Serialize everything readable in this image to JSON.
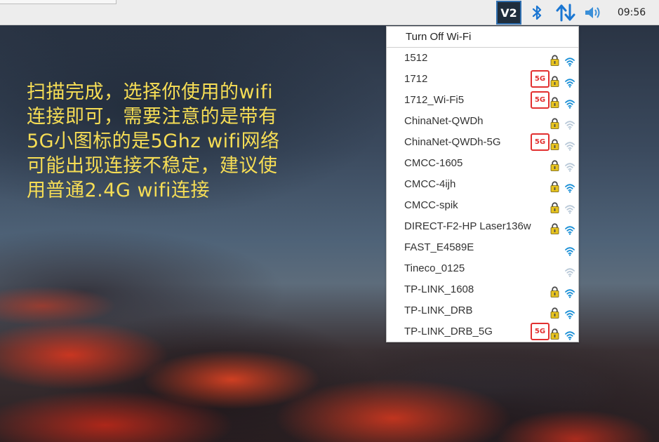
{
  "taskbar": {
    "vnc_label": "V2",
    "clock": "09:56",
    "icons": [
      "vnc-icon",
      "bluetooth-icon",
      "network-transfer-icon",
      "volume-icon"
    ]
  },
  "caption": {
    "lines": [
      "扫描完成，选择你使用的wifi",
      "连接即可，需要注意的是带有",
      "5G小图标的是5Ghz  wifi网络",
      "可能出现连接不稳定，建议使",
      "用普通2.4G wifi连接"
    ],
    "color": "#f6dd55"
  },
  "wifi_menu": {
    "turn_off_label": "Turn Off Wi-Fi",
    "badge_label": "5G",
    "networks": [
      {
        "name": "1512",
        "is_5g": false,
        "locked": true,
        "signal": "strong"
      },
      {
        "name": "1712",
        "is_5g": true,
        "locked": true,
        "signal": "strong"
      },
      {
        "name": "1712_Wi-Fi5",
        "is_5g": true,
        "locked": true,
        "signal": "strong"
      },
      {
        "name": "ChinaNet-QWDh",
        "is_5g": false,
        "locked": true,
        "signal": "weak"
      },
      {
        "name": "ChinaNet-QWDh-5G",
        "is_5g": true,
        "locked": true,
        "signal": "weak"
      },
      {
        "name": "CMCC-1605",
        "is_5g": false,
        "locked": true,
        "signal": "weak"
      },
      {
        "name": "CMCC-4ijh",
        "is_5g": false,
        "locked": true,
        "signal": "strong"
      },
      {
        "name": "CMCC-spik",
        "is_5g": false,
        "locked": true,
        "signal": "weak"
      },
      {
        "name": "DIRECT-F2-HP Laser136w",
        "is_5g": false,
        "locked": true,
        "signal": "strong"
      },
      {
        "name": "FAST_E4589E",
        "is_5g": false,
        "locked": false,
        "signal": "strong"
      },
      {
        "name": "Tineco_0125",
        "is_5g": false,
        "locked": false,
        "signal": "weak"
      },
      {
        "name": "TP-LINK_1608",
        "is_5g": false,
        "locked": true,
        "signal": "strong"
      },
      {
        "name": "TP-LINK_DRB",
        "is_5g": false,
        "locked": true,
        "signal": "strong"
      },
      {
        "name": "TP-LINK_DRB_5G",
        "is_5g": true,
        "locked": true,
        "signal": "strong"
      }
    ]
  },
  "colors": {
    "signal_strong": "#1a8fd6",
    "signal_weak": "#b9c9d8",
    "lock_body": "#e7c31f",
    "badge_border": "#e23030"
  }
}
